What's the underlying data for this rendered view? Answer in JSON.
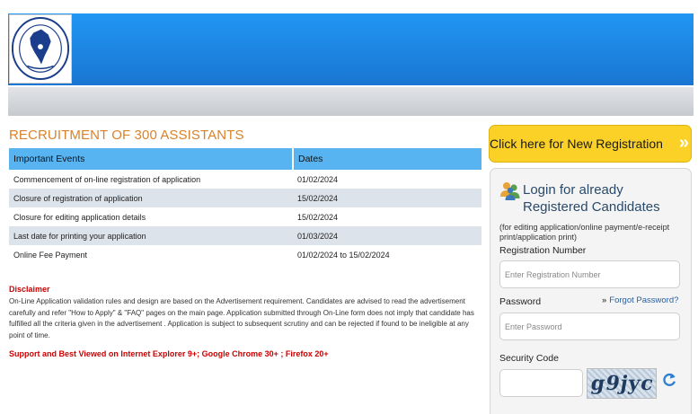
{
  "page": {
    "title": "RECRUITMENT OF 300 ASSISTANTS"
  },
  "events_table": {
    "headers": [
      "Important Events",
      "Dates"
    ],
    "rows": [
      [
        "Commencement of on-line registration of application",
        "01/02/2024"
      ],
      [
        "Closure of registration of application",
        "15/02/2024"
      ],
      [
        "Closure for editing application details",
        "15/02/2024"
      ],
      [
        "Last date for printing your application",
        "01/03/2024"
      ],
      [
        "Online Fee Payment",
        "01/02/2024 to 15/02/2024"
      ]
    ]
  },
  "disclaimer": {
    "title": "Disclaimer",
    "text": "On-Line Application validation rules and design are based on the Advertisement requirement. Candidates are advised to read the advertisement carefully and refer \"How to Apply\" & \"FAQ\" pages on the main page. Application submitted through On-Line form does not imply that candidate has fulfilled all the criteria given in the advertisement . Application is subject to subsequent scrutiny and can be rejected if found to be ineligible at any point of time."
  },
  "support_text": "Support and Best Viewed on Internet Explorer 9+; Google Chrome 30+ ; Firefox 20+",
  "new_registration": {
    "label": "Click here for New Registration",
    "arrow": "»"
  },
  "login": {
    "icon": "users-icon",
    "title": "Login for already Registered Candidates",
    "note": "(for editing application/online payment/e-receipt print/application print)",
    "registration_label": "Registration Number",
    "registration_placeholder": "Enter Registration Number",
    "password_label": "Password",
    "password_placeholder": "Enter Password",
    "forgot_chevron": "»",
    "forgot_label": "Forgot Password?",
    "security_label": "Security Code",
    "captcha_text": "g9jyc",
    "refresh_icon": "refresh-icon"
  },
  "colors": {
    "header_blue": "#1e88e5",
    "title_orange": "#d9822b",
    "table_header": "#57b4f0",
    "button_yellow": "#fcd127",
    "alert_red": "#cc0000"
  }
}
